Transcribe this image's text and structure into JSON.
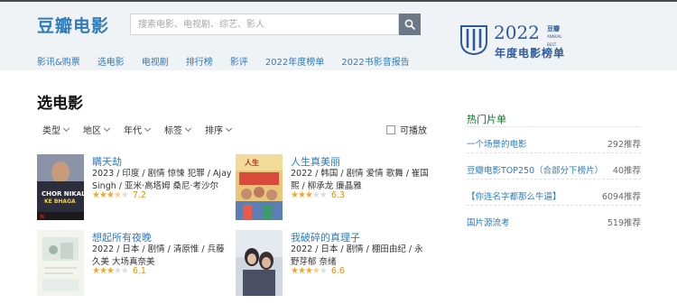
{
  "header": {
    "logo": "豆瓣电影",
    "search_placeholder": "搜索电影、电视剧、综艺、影人",
    "nav": [
      "影讯&购票",
      "选电影",
      "电视剧",
      "排行榜",
      "影评",
      "2022年度榜单",
      "2022书影音报告"
    ],
    "banner": {
      "year": "2022",
      "small": "豆瓣\nANNUAL\nBEST OF THE YEAR",
      "sub": "年度电影榜单",
      "color": "#2e5a99"
    }
  },
  "main": {
    "title": "选电影",
    "filters": [
      "类型",
      "地区",
      "年代",
      "标签",
      "排序"
    ],
    "playable_label": "可播放",
    "movies": [
      {
        "title": "瞒天劫",
        "meta": "2023 / 印度 / 剧情 惊悚 犯罪 / Ajay Singh / 亚米·高塔姆 桑尼·考沙尔",
        "stars": 3.5,
        "score": "7.2"
      },
      {
        "title": "人生真美丽",
        "meta": "2022 / 韩国 / 剧情 爱情 歌舞 / 崔国熙 / 柳承龙 廉晶雅",
        "stars": 3,
        "score": "6.3"
      },
      {
        "title": "想起所有夜晚",
        "meta": "2022 / 日本 / 剧情 / 清原惟 / 兵藤久美 大场真奈美",
        "stars": 3,
        "score": "6.1"
      },
      {
        "title": "我破碎的真理子",
        "meta": "2022 / 日本 / 剧情 / 棚田由纪 / 永野芽郁 奈绪",
        "stars": 3.5,
        "score": "6.6"
      }
    ]
  },
  "sidebar": {
    "title": "热门片单",
    "items": [
      {
        "name": "一个场景的电影",
        "count": "292推荐"
      },
      {
        "name": "豆瓣电影TOP250（合部分下榜片）",
        "count": "40推荐"
      },
      {
        "name": "【你连名字都那么牛逼】",
        "count": "6094推荐"
      },
      {
        "name": "国片源流考",
        "count": "519推荐"
      }
    ]
  },
  "colors": {
    "link": "#2e7bbd",
    "star": "#f5a623",
    "side_title": "#007722"
  }
}
